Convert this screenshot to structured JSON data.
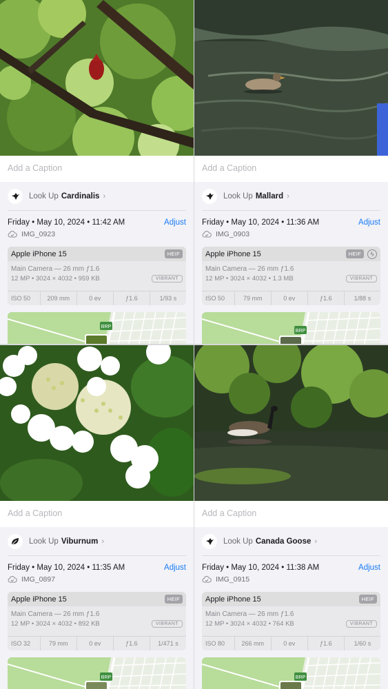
{
  "panels": [
    {
      "caption_placeholder": "Add a Caption",
      "lookup_label": "Look Up",
      "lookup_subject": "Cardinalis",
      "lookup_icon": "bird-icon",
      "date": "Friday • May 10, 2024 • 11:42 AM",
      "adjust_label": "Adjust",
      "file_name": "IMG_0923",
      "camera_model": "Apple iPhone 15",
      "format_badge": "HEIF",
      "lens": "Main Camera — 26 mm ƒ1.6",
      "specs": "12 MP  •  3024 × 4032  •  959 KB",
      "style_badge": "VIBRANT",
      "exif": [
        "ISO 50",
        "209 mm",
        "0 ev",
        "ƒ1.6",
        "1/93 s"
      ],
      "map_label": "BRP"
    },
    {
      "caption_placeholder": "Add a Caption",
      "lookup_label": "Look Up",
      "lookup_subject": "Mallard",
      "lookup_icon": "bird-icon",
      "date": "Friday • May 10, 2024 • 11:36 AM",
      "adjust_label": "Adjust",
      "file_name": "IMG_0903",
      "camera_model": "Apple iPhone 15",
      "format_badge": "HEIF",
      "flash_icon": "flash-off-icon",
      "lens": "Main Camera — 26 mm ƒ1.6",
      "specs": "12 MP  •  3024 × 4032  •  1.3 MB",
      "style_badge": "VIBRANT",
      "exif": [
        "ISO 50",
        "79 mm",
        "0 ev",
        "ƒ1.6",
        "1/88 s"
      ],
      "map_label": "BRP"
    },
    {
      "caption_placeholder": "Add a Caption",
      "lookup_label": "Look Up",
      "lookup_subject": "Viburnum",
      "lookup_icon": "leaf-icon",
      "date": "Friday • May 10, 2024 • 11:35 AM",
      "adjust_label": "Adjust",
      "file_name": "IMG_0897",
      "camera_model": "Apple iPhone 15",
      "format_badge": "HEIF",
      "lens": "Main Camera — 26 mm ƒ1.6",
      "specs": "12 MP  •  3024 × 4032  •  892 KB",
      "style_badge": "VIBRANT",
      "exif": [
        "ISO 32",
        "79 mm",
        "0 ev",
        "ƒ1.6",
        "1/471 s"
      ],
      "map_label": "BRP"
    },
    {
      "caption_placeholder": "Add a Caption",
      "lookup_label": "Look Up",
      "lookup_subject": "Canada Goose",
      "lookup_icon": "bird-icon",
      "date": "Friday • May 10, 2024 • 11:38 AM",
      "adjust_label": "Adjust",
      "file_name": "IMG_0915",
      "camera_model": "Apple iPhone 15",
      "format_badge": "HEIF",
      "lens": "Main Camera — 26 mm ƒ1.6",
      "specs": "12 MP  •  3024 × 4032  •  764 KB",
      "style_badge": "VIBRANT",
      "exif": [
        "ISO 80",
        "266 mm",
        "0 ev",
        "ƒ1.6",
        "1/60 s"
      ],
      "map_label": "BRP"
    }
  ],
  "colors": {
    "accent": "#1a7cf5",
    "panel_bg": "#f2f2f7"
  }
}
